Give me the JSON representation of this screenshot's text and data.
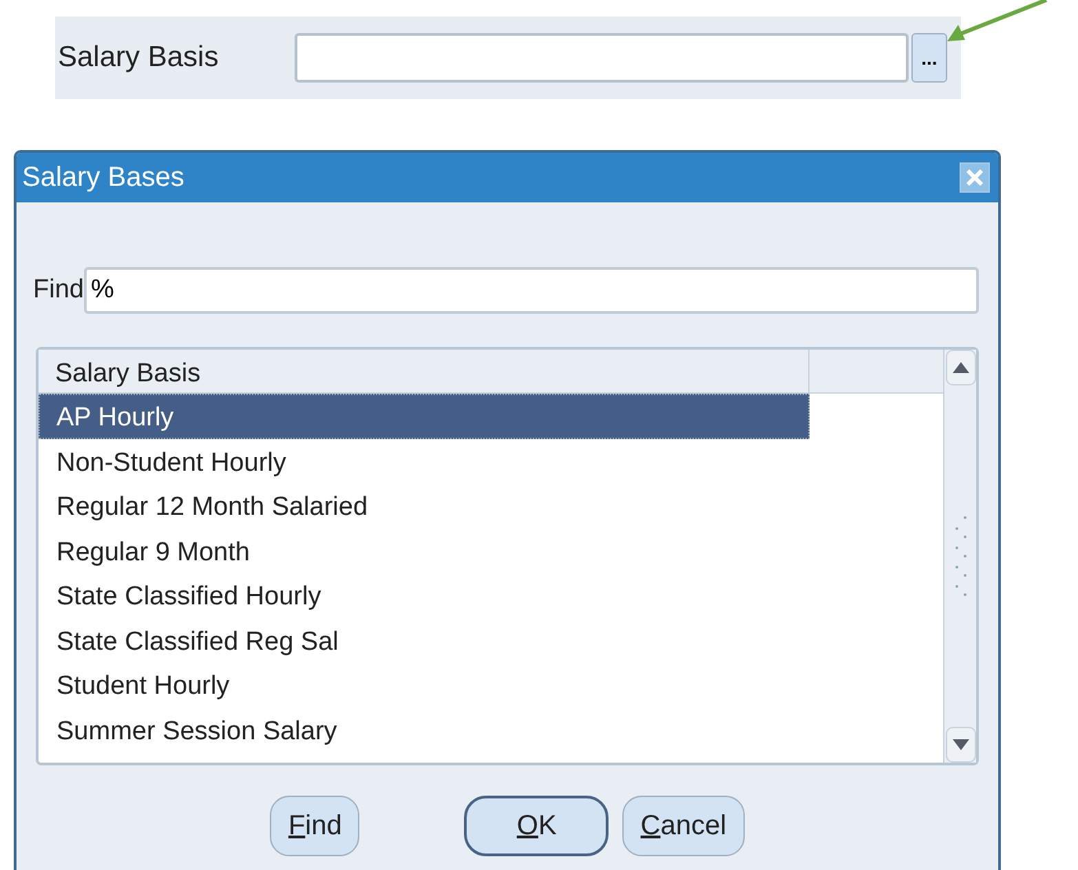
{
  "form": {
    "label": "Salary Basis",
    "lov_button": "..."
  },
  "dialog": {
    "title": "Salary Bases",
    "find_label": "Find",
    "find_value": "%",
    "list": {
      "columns": [
        "Salary Basis"
      ],
      "rows": [
        {
          "label": "AP Hourly",
          "selected": true
        },
        {
          "label": "Non-Student Hourly",
          "selected": false
        },
        {
          "label": "Regular 12 Month Salaried",
          "selected": false
        },
        {
          "label": "Regular 9 Month",
          "selected": false
        },
        {
          "label": "State Classified Hourly",
          "selected": false
        },
        {
          "label": "State Classified Reg Sal",
          "selected": false
        },
        {
          "label": "Student Hourly",
          "selected": false
        },
        {
          "label": "Summer Session Salary",
          "selected": false
        }
      ]
    },
    "buttons": [
      {
        "label": "Find",
        "default": false
      },
      {
        "label": "OK",
        "default": true
      },
      {
        "label": "Cancel",
        "default": false
      }
    ]
  }
}
